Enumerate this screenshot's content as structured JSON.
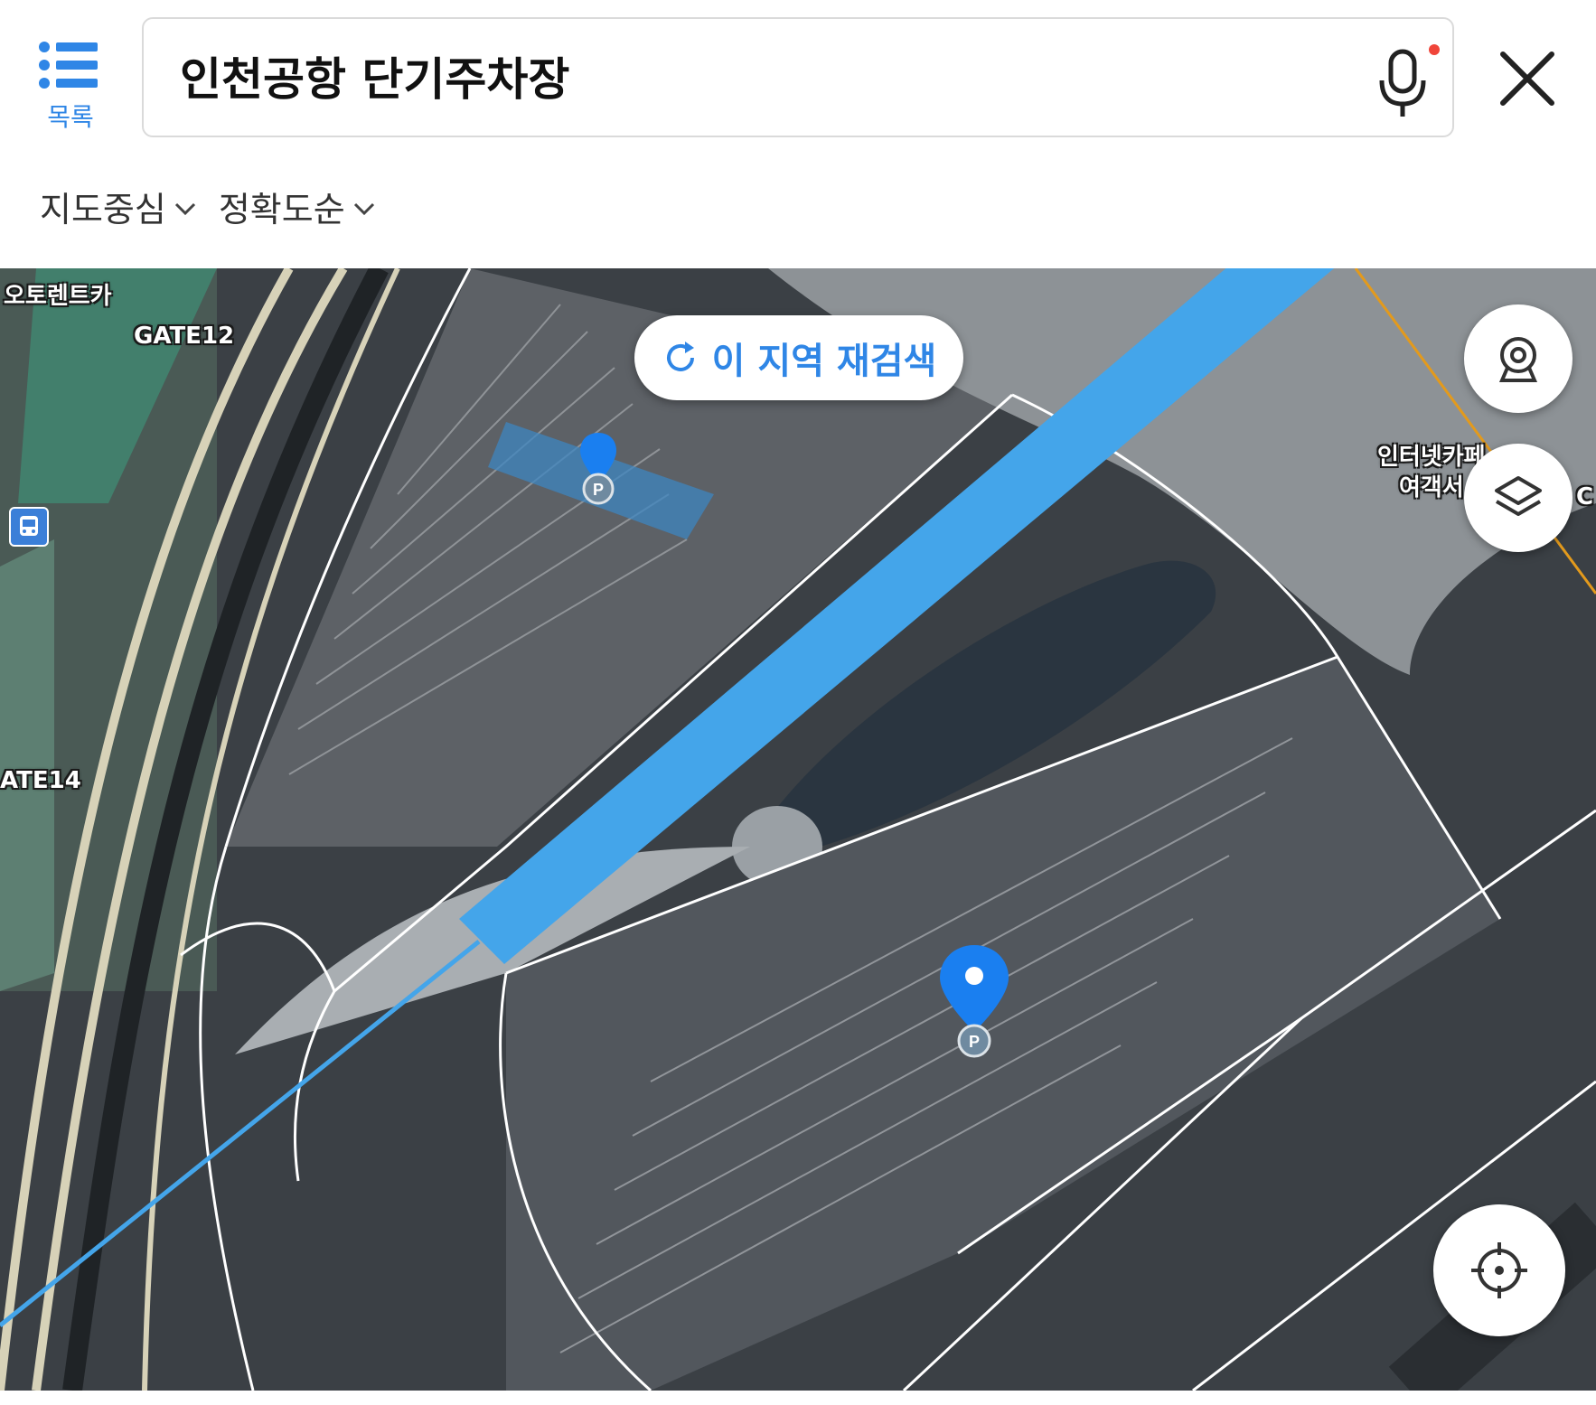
{
  "header": {
    "list_label": "목록",
    "search_value": "인천공항 단기주차장",
    "filters": [
      "지도중심",
      "정확도순"
    ]
  },
  "map": {
    "research_label": "이 지역 재검색",
    "labels": [
      "오토렌트카",
      "GATE12",
      "ATE14",
      "인터넷카페",
      "여객서",
      "C"
    ],
    "pins": [
      {
        "type": "parking",
        "selected": false
      },
      {
        "type": "parking",
        "selected": true
      }
    ],
    "icons": [
      "street-view-icon",
      "layers-icon",
      "current-location-icon",
      "bus-stop-icon"
    ]
  },
  "colors": {
    "accent": "#2f86e6",
    "route": "#44a5ea",
    "pin": "#1a7ff0"
  }
}
